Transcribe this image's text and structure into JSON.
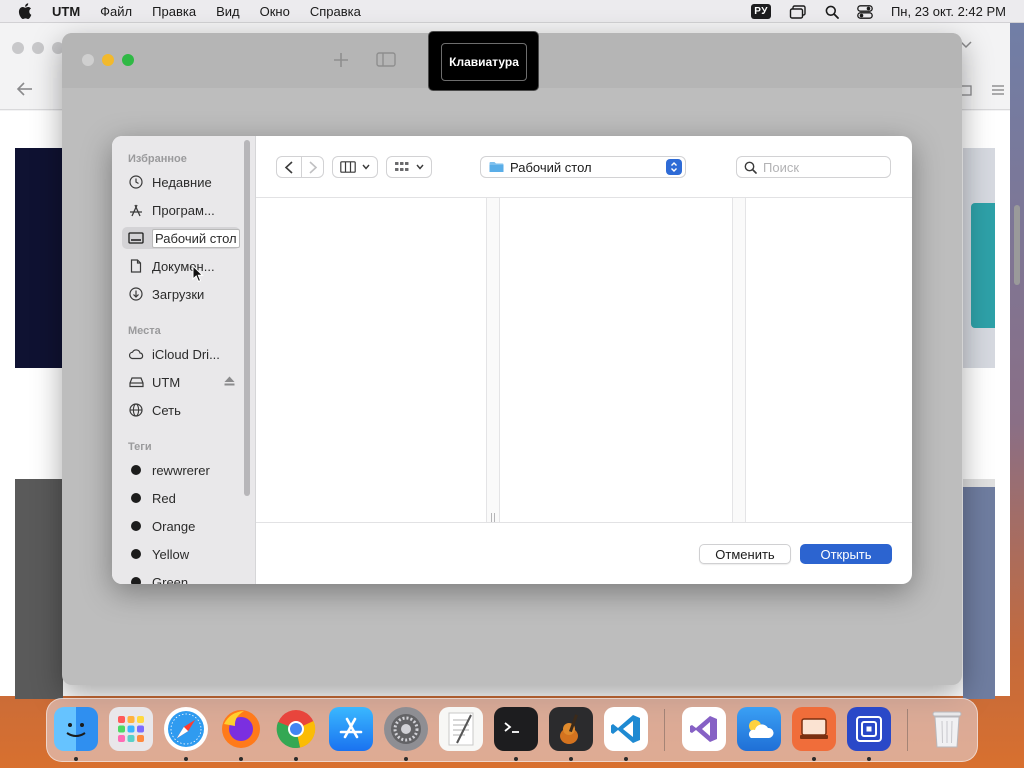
{
  "menubar": {
    "app_name": "UTM",
    "menus": [
      "Файл",
      "Правка",
      "Вид",
      "Окно",
      "Справка"
    ],
    "input_source": "РУ",
    "clock": "Пн, 23 окт.  2:42 PM"
  },
  "tooltip": {
    "text": "Клавиатура"
  },
  "dialog": {
    "sidebar": {
      "favorites_title": "Избранное",
      "favorites": [
        "Недавние",
        "Програм...",
        "Рабочий стол",
        "Докумен...",
        "Загрузки"
      ],
      "locations_title": "Места",
      "locations": [
        "iCloud Dri...",
        "UTM",
        "Сеть"
      ],
      "tags_title": "Теги",
      "tags": [
        "rewwrerer",
        "Red",
        "Orange",
        "Yellow",
        "Green"
      ]
    },
    "path_popup": "Рабочий стол",
    "search_placeholder": "Поиск",
    "cancel_label": "Отменить",
    "open_label": "Открыть"
  },
  "colors": {
    "accent": "#2c64d0",
    "close": "#ff5f57",
    "minimize": "#febc2e",
    "zoom": "#28c840"
  }
}
